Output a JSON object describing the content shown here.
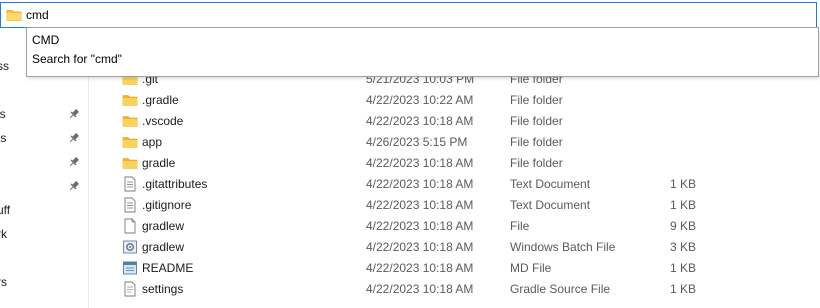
{
  "address_bar": {
    "value": "cmd",
    "suggestions": [
      {
        "label": "CMD"
      },
      {
        "label": "Search for \"cmd\""
      }
    ]
  },
  "nav_pane": {
    "items": [
      {
        "label": "ss",
        "pinned": false
      },
      {
        "label": "ls",
        "pinned": true
      },
      {
        "label": "ts",
        "pinned": true
      },
      {
        "label": "",
        "pinned": true
      },
      {
        "label": "",
        "pinned": true
      },
      {
        "label": "uff",
        "pinned": false
      },
      {
        "label": "rk",
        "pinned": false
      },
      {
        "label": "rs",
        "pinned": false
      }
    ]
  },
  "files": [
    {
      "name": ".git",
      "date": "5/21/2023 10:03 PM",
      "type": "File folder",
      "size": "",
      "icon": "folder-icon"
    },
    {
      "name": ".gradle",
      "date": "4/22/2023 10:22 AM",
      "type": "File folder",
      "size": "",
      "icon": "folder-icon"
    },
    {
      "name": ".vscode",
      "date": "4/22/2023 10:18 AM",
      "type": "File folder",
      "size": "",
      "icon": "folder-icon"
    },
    {
      "name": "app",
      "date": "4/26/2023 5:15 PM",
      "type": "File folder",
      "size": "",
      "icon": "folder-icon"
    },
    {
      "name": "gradle",
      "date": "4/22/2023 10:18 AM",
      "type": "File folder",
      "size": "",
      "icon": "folder-icon"
    },
    {
      "name": ".gitattributes",
      "date": "4/22/2023 10:18 AM",
      "type": "Text Document",
      "size": "1 KB",
      "icon": "text-document-icon"
    },
    {
      "name": ".gitignore",
      "date": "4/22/2023 10:18 AM",
      "type": "Text Document",
      "size": "1 KB",
      "icon": "text-document-icon"
    },
    {
      "name": "gradlew",
      "date": "4/22/2023 10:18 AM",
      "type": "File",
      "size": "9 KB",
      "icon": "blank-file-icon"
    },
    {
      "name": "gradlew",
      "date": "4/22/2023 10:18 AM",
      "type": "Windows Batch File",
      "size": "3 KB",
      "icon": "batch-file-icon"
    },
    {
      "name": "README",
      "date": "4/22/2023 10:18 AM",
      "type": "MD File",
      "size": "1 KB",
      "icon": "md-file-icon"
    },
    {
      "name": "settings",
      "date": "4/22/2023 10:18 AM",
      "type": "Gradle Source File",
      "size": "1 KB",
      "icon": "gradle-file-icon"
    }
  ]
}
